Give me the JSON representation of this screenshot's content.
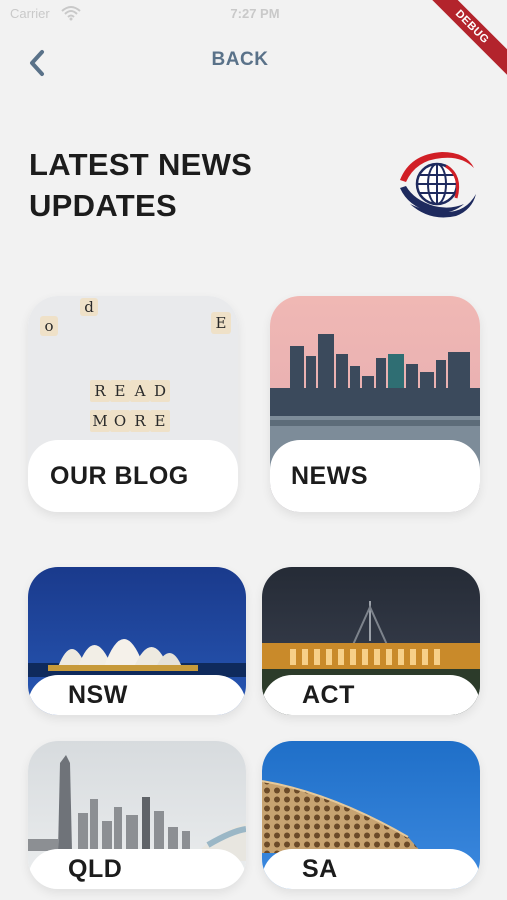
{
  "status_bar": {
    "carrier": "Carrier",
    "time": "7:27 PM",
    "debug_label": "DEBUG"
  },
  "header": {
    "back_label": "BACK"
  },
  "page": {
    "title_line1": "LATEST NEWS",
    "title_line2": "UPDATES"
  },
  "cards": [
    {
      "label": "OUR BLOG",
      "image": "read-more-letter-tiles",
      "tiles": [
        "R",
        "E",
        "A",
        "D",
        "M",
        "O",
        "R",
        "E",
        "o",
        "d",
        "E"
      ]
    },
    {
      "label": "NEWS",
      "image": "city-skyline-at-dusk"
    },
    {
      "label": "NSW",
      "image": "sydney-opera-house"
    },
    {
      "label": "ACT",
      "image": "parliament-house-at-night"
    },
    {
      "label": "QLD",
      "image": "gold-coast-skyline"
    },
    {
      "label": "SA",
      "image": "honeycomb-building-facade"
    }
  ],
  "colors": {
    "accent": "#5a7289",
    "background": "#f2f2f2",
    "debug": "#b3242c",
    "logo_red": "#d11f26",
    "logo_navy": "#1e2a5e"
  }
}
